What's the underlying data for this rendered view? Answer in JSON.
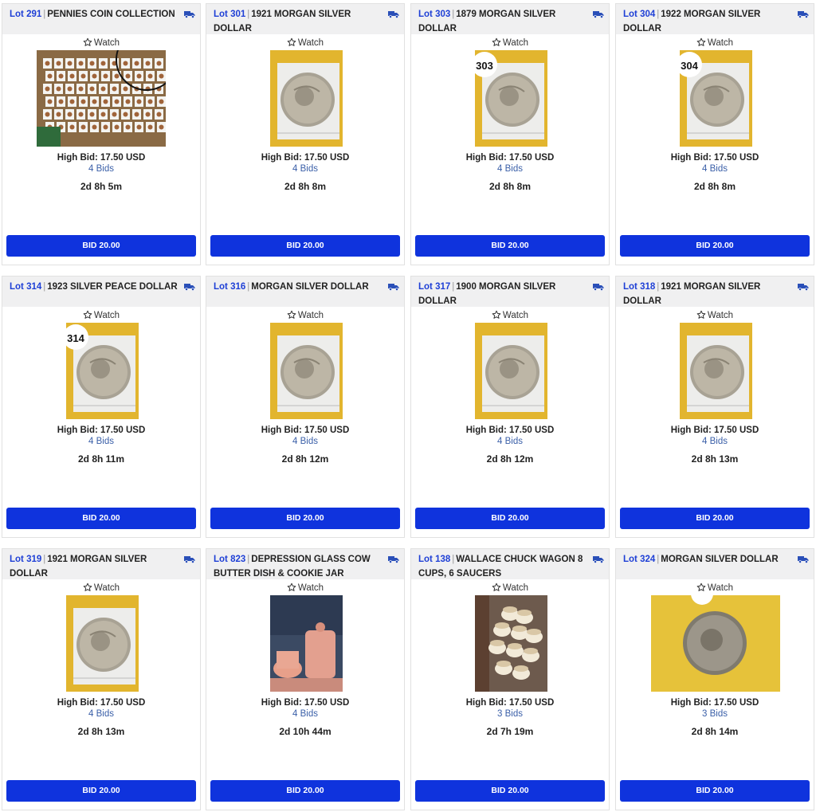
{
  "cards": [
    {
      "lot": "Lot 291",
      "title": "PENNIES COIN COLLECTION",
      "watch": "Watch",
      "photo": "pennies-collection-photo",
      "high_bid": "High Bid: 17.50 USD",
      "bids": "4 Bids",
      "time_left": "2d 8h 5m",
      "bid_button": "BID 20.00"
    },
    {
      "lot": "Lot 301",
      "title": "1921 MORGAN SILVER DOLLAR",
      "watch": "Watch",
      "photo": "coin-photo",
      "high_bid": "High Bid: 17.50 USD",
      "bids": "4 Bids",
      "time_left": "2d 8h 8m",
      "bid_button": "BID 20.00"
    },
    {
      "lot": "Lot 303",
      "title": "1879 MORGAN SILVER DOLLAR",
      "watch": "Watch",
      "photo": "coin-photo",
      "photo_label": "303",
      "high_bid": "High Bid: 17.50 USD",
      "bids": "4 Bids",
      "time_left": "2d 8h 8m",
      "bid_button": "BID 20.00"
    },
    {
      "lot": "Lot 304",
      "title": "1922 MORGAN SILVER DOLLAR",
      "watch": "Watch",
      "photo": "coin-photo",
      "photo_label": "304",
      "high_bid": "High Bid: 17.50 USD",
      "bids": "4 Bids",
      "time_left": "2d 8h 8m",
      "bid_button": "BID 20.00"
    },
    {
      "lot": "Lot 314",
      "title": "1923 SILVER PEACE DOLLAR",
      "watch": "Watch",
      "photo": "coin-photo",
      "photo_label": "314",
      "high_bid": "High Bid: 17.50 USD",
      "bids": "4 Bids",
      "time_left": "2d 8h 11m",
      "bid_button": "BID 20.00"
    },
    {
      "lot": "Lot 316",
      "title": "MORGAN SILVER DOLLAR",
      "watch": "Watch",
      "photo": "coin-photo",
      "high_bid": "High Bid: 17.50 USD",
      "bids": "4 Bids",
      "time_left": "2d 8h 12m",
      "bid_button": "BID 20.00"
    },
    {
      "lot": "Lot 317",
      "title": "1900 MORGAN SILVER DOLLAR",
      "watch": "Watch",
      "photo": "coin-photo",
      "high_bid": "High Bid: 17.50 USD",
      "bids": "4 Bids",
      "time_left": "2d 8h 12m",
      "bid_button": "BID 20.00"
    },
    {
      "lot": "Lot 318",
      "title": "1921 MORGAN SILVER DOLLAR",
      "watch": "Watch",
      "photo": "coin-photo",
      "high_bid": "High Bid: 17.50 USD",
      "bids": "4 Bids",
      "time_left": "2d 8h 13m",
      "bid_button": "BID 20.00"
    },
    {
      "lot": "Lot 319",
      "title": "1921 MORGAN SILVER DOLLAR",
      "watch": "Watch",
      "photo": "coin-photo",
      "high_bid": "High Bid: 17.50 USD",
      "bids": "4 Bids",
      "time_left": "2d 8h 13m",
      "bid_button": "BID 20.00"
    },
    {
      "lot": "Lot 823",
      "title": "DEPRESSION GLASS COW BUTTER DISH & COOKIE JAR",
      "watch": "Watch",
      "photo": "glass-jar-photo",
      "high_bid": "High Bid: 17.50 USD",
      "bids": "4 Bids",
      "time_left": "2d 10h 44m",
      "bid_button": "BID 20.00"
    },
    {
      "lot": "Lot 138",
      "title": "WALLACE CHUCK WAGON 8 CUPS, 6 SAUCERS",
      "watch": "Watch",
      "photo": "cups-photo",
      "high_bid": "High Bid: 17.50 USD",
      "bids": "3 Bids",
      "time_left": "2d 7h 19m",
      "bid_button": "BID 20.00"
    },
    {
      "lot": "Lot 324",
      "title": "MORGAN SILVER DOLLAR",
      "watch": "Watch",
      "photo": "coin-yellow-photo",
      "high_bid": "High Bid: 17.50 USD",
      "bids": "3 Bids",
      "time_left": "2d 8h 14m",
      "bid_button": "BID 20.00"
    }
  ],
  "colors": {
    "lot_link": "#1e3fd6",
    "bid_button": "#0f33dd",
    "bids_text": "#3a5fa8",
    "header_bg": "#f0f0f1"
  },
  "icons": {
    "shipping": "truck-icon",
    "watch": "star-outline-icon"
  }
}
